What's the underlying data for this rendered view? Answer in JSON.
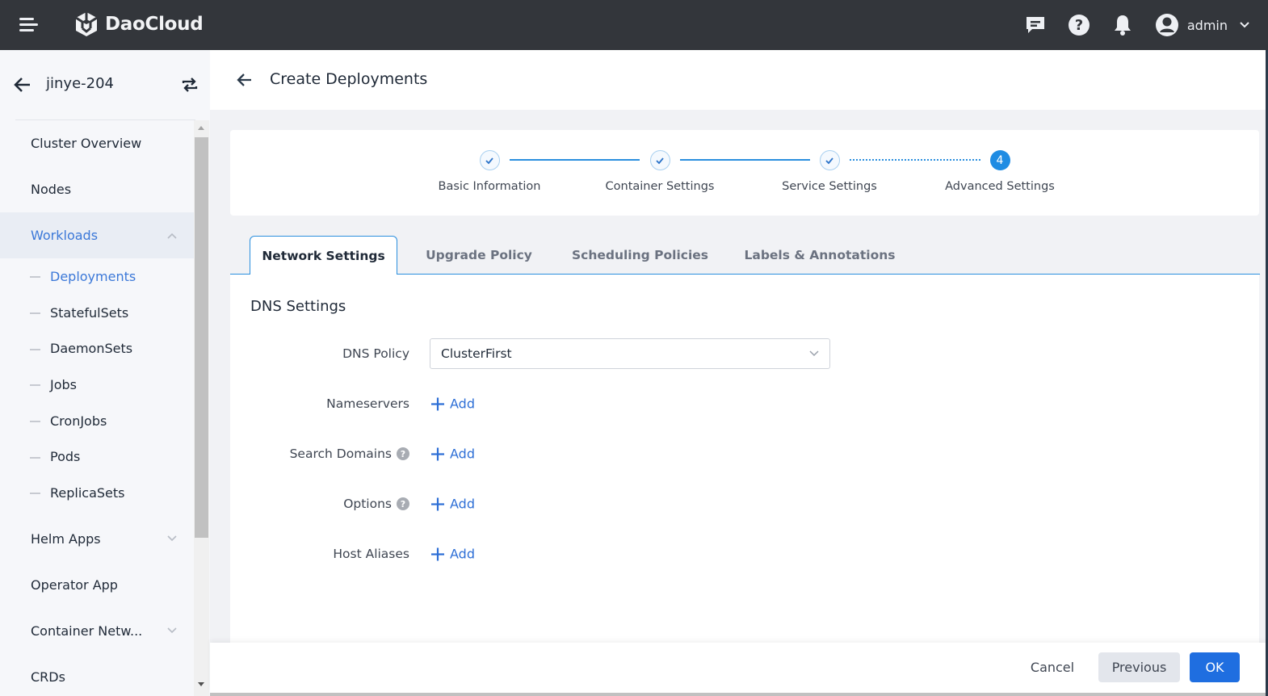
{
  "app": {
    "brand": "DaoCloud",
    "user_name": "admin",
    "colors": {
      "topbar": "#33363b",
      "accent": "#2b8fde",
      "link": "#2e6fd6",
      "primary_button": "#1f6ee0"
    }
  },
  "topbar_icons": [
    "menu-icon",
    "message-icon",
    "help-icon",
    "bell-icon",
    "user-avatar-icon",
    "chevron-down-icon"
  ],
  "sidebar": {
    "cluster_name": "jinye-204",
    "items": [
      {
        "label": "Cluster Overview"
      },
      {
        "label": "Nodes"
      },
      {
        "label": "Workloads",
        "expanded": true,
        "active": true
      },
      {
        "label": "Helm Apps",
        "expandable": true
      },
      {
        "label": "Operator App"
      },
      {
        "label": "Container Netw...",
        "expandable": true
      },
      {
        "label": "CRDs"
      }
    ],
    "workload_children": [
      {
        "label": "Deployments",
        "active": true
      },
      {
        "label": "StatefulSets"
      },
      {
        "label": "DaemonSets"
      },
      {
        "label": "Jobs"
      },
      {
        "label": "CronJobs"
      },
      {
        "label": "Pods"
      },
      {
        "label": "ReplicaSets"
      }
    ]
  },
  "page": {
    "title": "Create Deployments"
  },
  "steps": [
    {
      "label": "Basic Information",
      "status": "done"
    },
    {
      "label": "Container Settings",
      "status": "done"
    },
    {
      "label": "Service Settings",
      "status": "done"
    },
    {
      "label": "Advanced Settings",
      "status": "current",
      "number": "4"
    }
  ],
  "tabs": [
    {
      "label": "Network Settings",
      "active": true
    },
    {
      "label": "Upgrade Policy"
    },
    {
      "label": "Scheduling Policies"
    },
    {
      "label": "Labels & Annotations"
    }
  ],
  "form": {
    "section_title": "DNS Settings",
    "dns_policy": {
      "label": "DNS Policy",
      "value": "ClusterFirst"
    },
    "rows": [
      {
        "label": "Nameservers",
        "help": false,
        "action": "Add"
      },
      {
        "label": "Search Domains",
        "help": true,
        "action": "Add"
      },
      {
        "label": "Options",
        "help": true,
        "action": "Add"
      },
      {
        "label": "Host Aliases",
        "help": false,
        "action": "Add"
      }
    ]
  },
  "footer": {
    "cancel": "Cancel",
    "previous": "Previous",
    "ok": "OK"
  }
}
